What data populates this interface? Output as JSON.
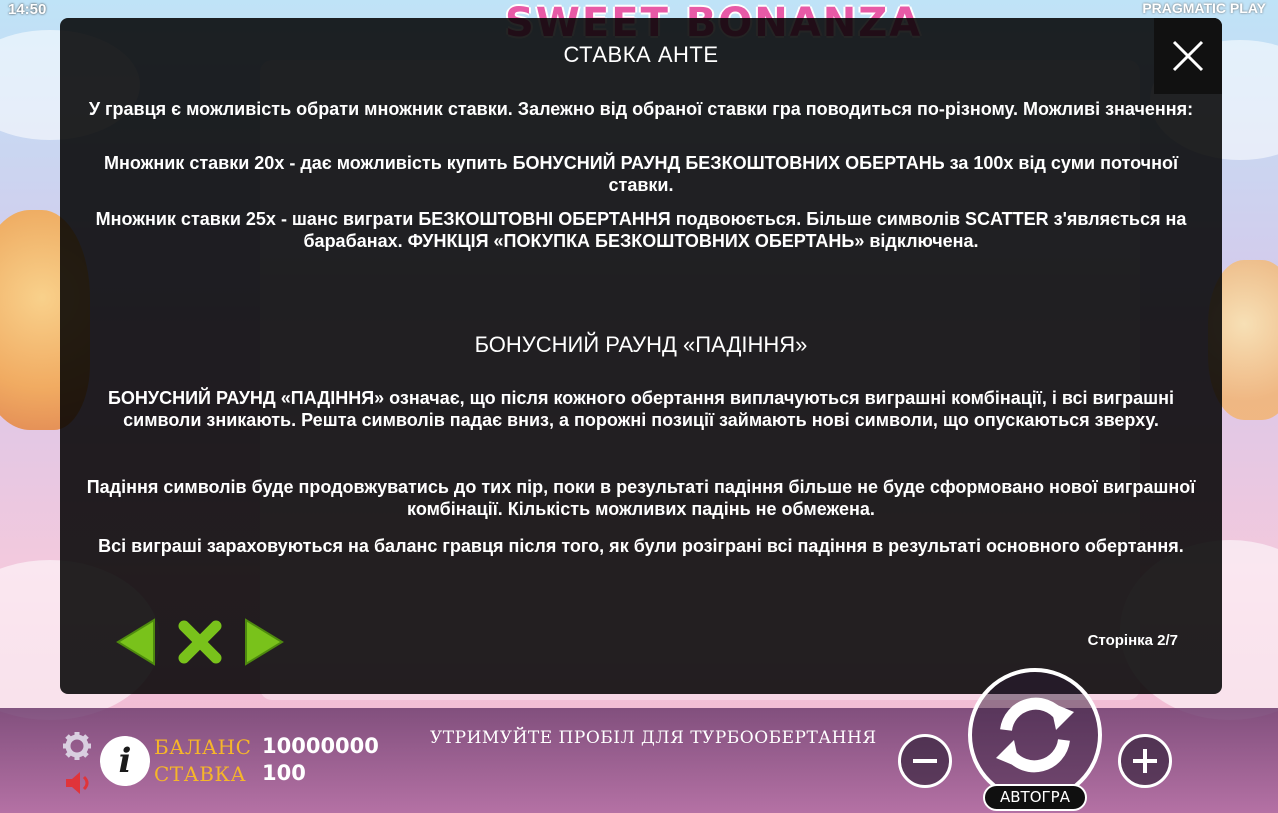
{
  "status_bar": {
    "clock": "14:50",
    "provider": "PRAGMATIC PLAY"
  },
  "game": {
    "logo": "SWEET BONANZA"
  },
  "info_panel": {
    "title": "СТАВКА АНТЕ",
    "intro": "У гравця є можливість обрати множник ставки. Залежно від обраної ставки гра поводиться по-різному. Можливі значення:",
    "option_20x": "Множник ставки 20x - дає можливість купить БОНУСНИЙ РАУНД БЕЗКОШТОВНИХ ОБЕРТАНЬ за 100x від суми поточної ставки.",
    "option_25x": "Множник ставки 25x - шанс виграти БЕЗКОШТОВНІ ОБЕРТАННЯ подвоюється. Більше символів SCATTER з'являється на барабанах. ФУНКЦІЯ «ПОКУПКА БЕЗКОШТОВНИХ ОБЕРТАНЬ» відключена.",
    "section_title": "БОНУСНИЙ РАУНД «ПАДІННЯ»",
    "tumble_desc": "БОНУСНИЙ РАУНД «ПАДІННЯ» означає, що після кожного обертання виплачуються виграшні комбінації, і всі виграшні символи зникають. Решта символів падає вниз, а порожні позиції займають нові символи, що опускаються зверху.",
    "tumble_continue": "Падіння символів буде продовжуватись до тих пір, поки в результаті падіння більше не буде сформовано нової виграшної комбінації. Кількість можливих падінь не обмежена.",
    "tumble_payout": "Всі виграші зараховуються на баланс гравця після того, як були розіграні всі падіння в результаті основного обертання.",
    "page_label": "Сторінка 2/7",
    "accent_color": "#79c21b"
  },
  "bottom_bar": {
    "balance_label": "БАЛАНС",
    "balance_value": "10000000",
    "bet_label": "СТАВКА",
    "bet_value": "100",
    "hint": "УТРИМУЙТЕ ПРОБІЛ ДЛЯ ТУРБООБЕРТАННЯ",
    "info_glyph": "i",
    "autoplay_label": "АВТОГРА",
    "label_color": "#f6b629"
  }
}
